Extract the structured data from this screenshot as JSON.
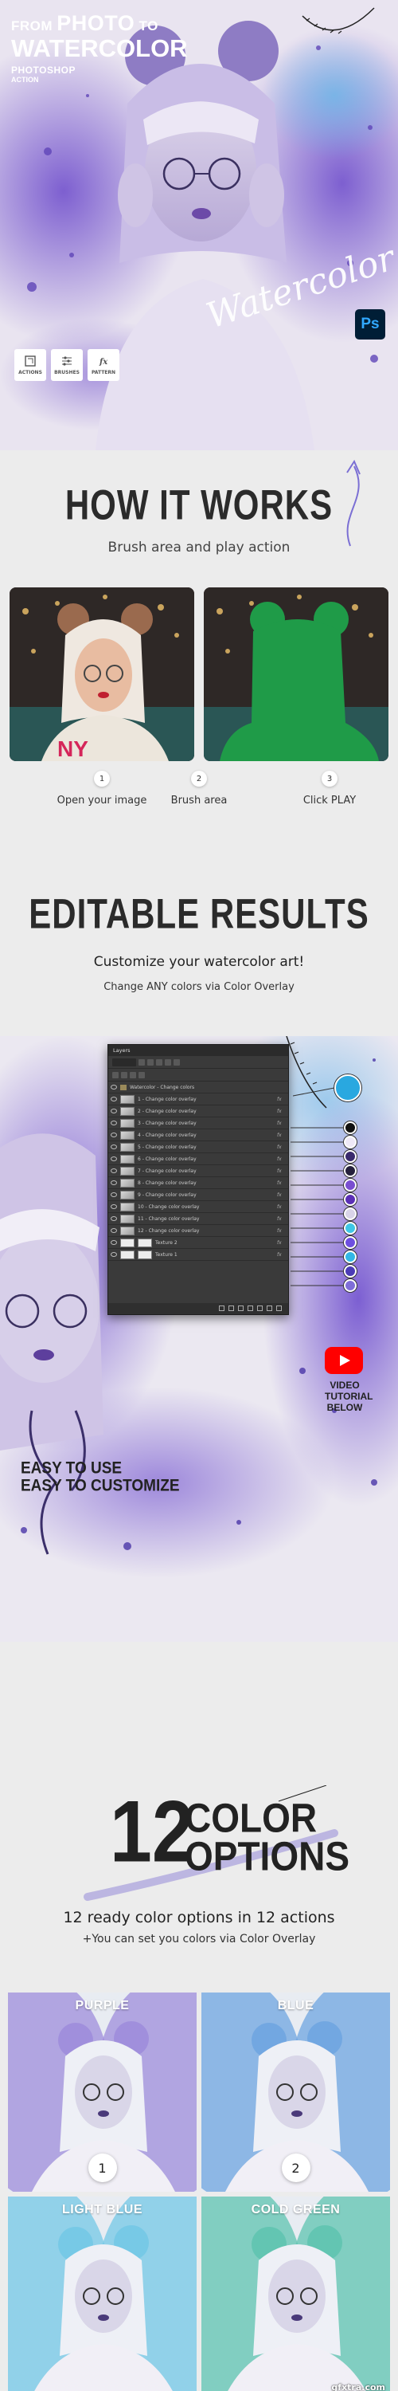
{
  "hero": {
    "title_from": "FROM",
    "title_photo": "PHOTO",
    "title_to": "TO",
    "title_watercolor": "WATERCOLOR",
    "subtitle_line1": "PHOTOSHOP",
    "subtitle_line2": "ACTION",
    "script_text": "Watercolor",
    "ps_badge": "Ps",
    "badges": [
      {
        "label": "ACTIONS",
        "icon": "actions-icon"
      },
      {
        "label": "BRUSHES",
        "icon": "brushes-icon"
      },
      {
        "label": "PATTERN",
        "icon": "fx-pattern-icon"
      }
    ],
    "accent_color": "#8a6fd4"
  },
  "how": {
    "title": "HOW IT WORKS",
    "subtitle": "Brush area and play action",
    "steps": [
      {
        "num": "1",
        "label": "Open your image"
      },
      {
        "num": "2",
        "label": "Brush area"
      },
      {
        "num": "3",
        "label": "Click PLAY"
      }
    ],
    "mask_color": "#1f9b48"
  },
  "editable": {
    "title": "EDITABLE RESULTS",
    "subtitle": "Customize your watercolor art!",
    "note": "Change ANY colors via Color Overlay"
  },
  "panel": {
    "tab": "Layers",
    "kind": "Kind",
    "group": "Watercolor - Change colors",
    "layers": [
      "1 - Change color overlay",
      "2 - Change color overlay",
      "3 - Change color overlay",
      "4 - Change color overlay",
      "5 - Change color overlay",
      "6 - Change color overlay",
      "7 - Change color overlay",
      "8 - Change color overlay",
      "9 - Change color overlay",
      "10 - Change color overlay",
      "11 - Change color overlay",
      "12 - Change color overlay",
      "Texture 2",
      "Texture 1"
    ],
    "fx": "fx",
    "swatches": [
      "#29a8e0",
      "#111111",
      "#efe9f7",
      "#3a2a6d",
      "#25203c",
      "#7a4fd0",
      "#5b2fb6",
      "#d9d4e8",
      "#3fc6e6",
      "#6e4fe0",
      "#33b7e6",
      "#4b3bb6",
      "#7f6ed8"
    ]
  },
  "video": {
    "line1": "VIDEO",
    "line2": "TUTORIAL",
    "line3": "BELOW"
  },
  "easy": {
    "line1": "EASY TO USE",
    "line2": "EASY TO CUSTOMIZE"
  },
  "options": {
    "number": "12",
    "word1": "COLOR",
    "word2": "OPTIONS",
    "subtitle": "12 ready color options in 12 actions",
    "note": "+You can set you colors via Color Overlay",
    "cards": [
      {
        "label": "PURPLE",
        "num": "1",
        "tint": "#9f8ddb"
      },
      {
        "label": "BLUE",
        "num": "2",
        "tint": "#6fa5e0"
      },
      {
        "label": "LIGHT BLUE",
        "num": "",
        "tint": "#74c8e6"
      },
      {
        "label": "COLD GREEN",
        "num": "",
        "tint": "#5fc4b0"
      }
    ],
    "watermark": "gfxtra.com"
  }
}
